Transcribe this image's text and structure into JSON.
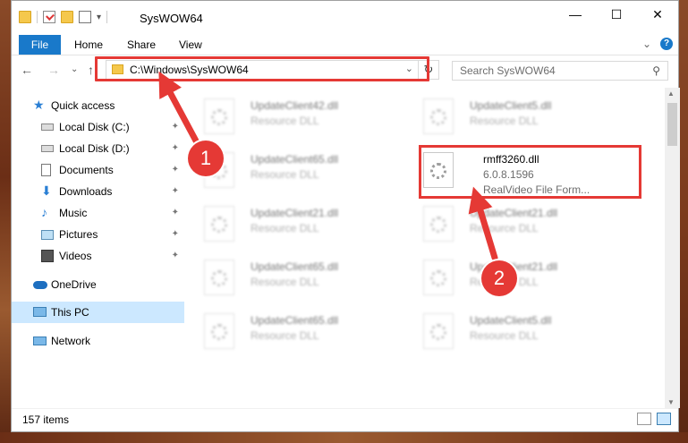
{
  "window": {
    "title": "SysWOW64",
    "buttons": {
      "minimize": "—",
      "maximize": "☐",
      "close": "✕"
    }
  },
  "ribbon": {
    "tabs": [
      "File",
      "Home",
      "Share",
      "View"
    ],
    "expand": "⌄",
    "help": "?"
  },
  "nav": {
    "back": "←",
    "forward": "→",
    "dropdown": "⌄",
    "up": "↑",
    "address": "C:\\Windows\\SysWOW64",
    "address_dropdown": "⌄",
    "refresh": "↻",
    "search_placeholder": "Search SysWOW64",
    "search_icon": "⚲"
  },
  "sidebar": {
    "items": [
      {
        "label": "Quick access",
        "icon": "star-icon",
        "pinned": false
      },
      {
        "label": "Local Disk (C:)",
        "icon": "drive-icon",
        "pinned": true
      },
      {
        "label": "Local Disk (D:)",
        "icon": "drive-icon",
        "pinned": true
      },
      {
        "label": "Documents",
        "icon": "documents-icon",
        "pinned": true
      },
      {
        "label": "Downloads",
        "icon": "downloads-icon",
        "pinned": true
      },
      {
        "label": "Music",
        "icon": "music-icon",
        "pinned": true
      },
      {
        "label": "Pictures",
        "icon": "pictures-icon",
        "pinned": true
      },
      {
        "label": "Videos",
        "icon": "videos-icon",
        "pinned": true
      },
      {
        "label": "OneDrive",
        "icon": "cloud-icon",
        "pinned": false
      },
      {
        "label": "This PC",
        "icon": "computer-icon",
        "pinned": false,
        "selected": true
      },
      {
        "label": "Network",
        "icon": "network-icon",
        "pinned": false
      }
    ],
    "pin_glyph": "📌"
  },
  "files": [
    {
      "name": "UpdateClient42.dll",
      "type": "Resource DLL",
      "blurred": true
    },
    {
      "name": "UpdateClient5.dll",
      "type": "Resource DLL",
      "blurred": true
    },
    {
      "name": "UpdateClient65.dll",
      "type": "Resource DLL",
      "blurred": true
    },
    {
      "name": "rmff3260.dll",
      "version": "6.0.8.1596",
      "description": "RealVideo File Form...",
      "blurred": false
    },
    {
      "name": "UpdateClient21.dll",
      "type": "Resource DLL",
      "blurred": true
    },
    {
      "name": "UpdateClient21.dll",
      "type": "Resource DLL",
      "blurred": true
    },
    {
      "name": "UpdateClient65.dll",
      "type": "Resource DLL",
      "blurred": true
    },
    {
      "name": "UpdateClient21.dll",
      "type": "Resource DLL",
      "blurred": true
    },
    {
      "name": "UpdateClient65.dll",
      "type": "Resource DLL",
      "blurred": true
    },
    {
      "name": "UpdateClient5.dll",
      "type": "Resource DLL",
      "blurred": true
    }
  ],
  "status": {
    "count": "157 items"
  },
  "annotations": {
    "step1": "1",
    "step2": "2",
    "accent": "#e53935"
  },
  "colors": {
    "file_tab": "#1979ca",
    "selected": "#cce8ff"
  }
}
